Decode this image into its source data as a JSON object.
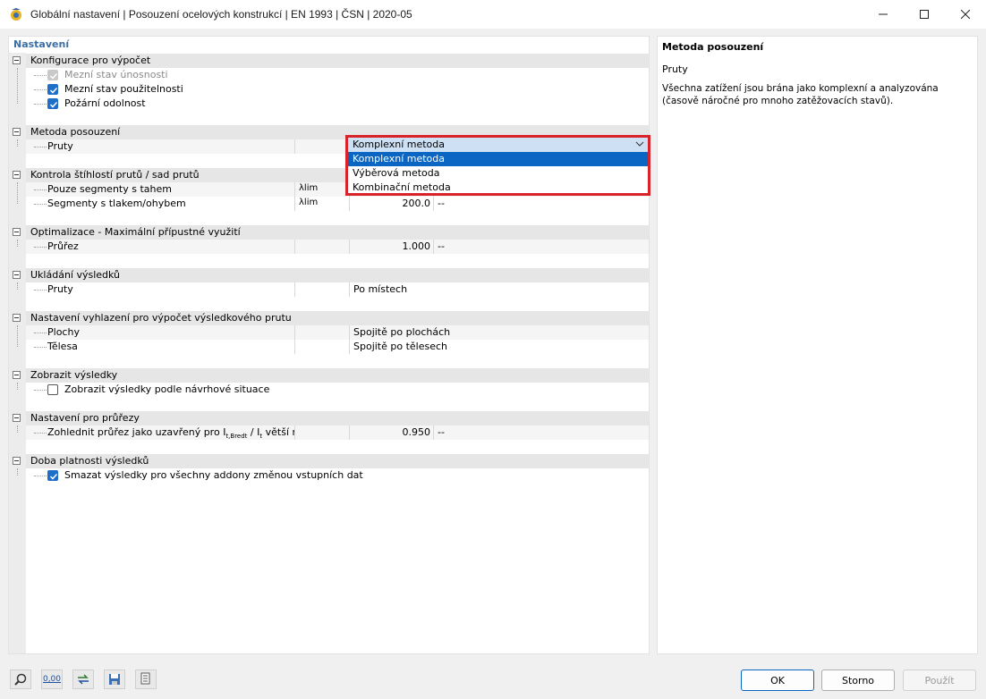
{
  "window": {
    "title": "Globální nastavení | Posouzení ocelových konstrukcí | EN 1993 | ČSN | 2020-05",
    "minimize": "–",
    "maximize": "□",
    "close": "✕"
  },
  "settings": {
    "header": "Nastavení",
    "groups": {
      "config": {
        "label": "Konfigurace pro výpočet",
        "items": [
          {
            "label": "Mezní stav únosnosti",
            "checked": true,
            "disabled": true
          },
          {
            "label": "Mezní stav použitelnosti",
            "checked": true,
            "disabled": false
          },
          {
            "label": "Požární odolnost",
            "checked": true,
            "disabled": false
          }
        ]
      },
      "method": {
        "label": "Metoda posouzení",
        "members_label": "Pruty",
        "selected": "Komplexní metoda",
        "options": [
          "Komplexní metoda",
          "Výběrová metoda",
          "Kombinační metoda"
        ]
      },
      "slenderness": {
        "label": "Kontrola štíhlostí prutů / sad prutů",
        "rows": [
          {
            "label": "Pouze segmenty s tahem",
            "symbol": "λlim",
            "value": "",
            "unit": ""
          },
          {
            "label": "Segmenty s tlakem/ohybem",
            "symbol": "λlim",
            "value": "200.0",
            "unit": "--"
          }
        ]
      },
      "optimization": {
        "label": "Optimalizace - Maximální přípustné využití",
        "rows": [
          {
            "label": "Průřez",
            "symbol": "",
            "value": "1.000",
            "unit": "--"
          }
        ]
      },
      "saving": {
        "label": "Ukládání výsledků",
        "rows": [
          {
            "label": "Pruty",
            "value": "Po místech"
          }
        ]
      },
      "smoothing": {
        "label": "Nastavení vyhlazení pro výpočet výsledkového prutu",
        "rows": [
          {
            "label": "Plochy",
            "value": "Spojitě po plochách"
          },
          {
            "label": "Tělesa",
            "value": "Spojitě po tělesech"
          }
        ]
      },
      "show": {
        "label": "Zobrazit výsledky",
        "items": [
          {
            "label": "Zobrazit výsledky podle návrhové situace",
            "checked": false
          }
        ]
      },
      "section": {
        "label": "Nastavení pro průřezy",
        "rows": [
          {
            "label": "Zohlednit průřez jako uzavřený pro I",
            "sub": "t,Bredt",
            "label_mid": " / I",
            "sub2": "t",
            "label_end": " větší n···",
            "value": "0.950",
            "unit": "--"
          }
        ]
      },
      "validity": {
        "label": "Doba platnosti výsledků",
        "items": [
          {
            "label": "Smazat výsledky pro všechny addony změnou vstupních dat",
            "checked": true
          }
        ]
      }
    }
  },
  "info": {
    "title": "Metoda posouzení",
    "subtitle": "Pruty",
    "description": "Všechna zatížení jsou brána jako komplexní a analyzována (časově náročné pro mnoho zatěžovacích stavů)."
  },
  "footer": {
    "icon_value": "0,00",
    "ok": "OK",
    "cancel": "Storno",
    "apply": "Použít"
  },
  "colors": {
    "highlight_border": "#d8232a",
    "selection": "#0a66c2",
    "header_blue": "#3b6ea5"
  }
}
